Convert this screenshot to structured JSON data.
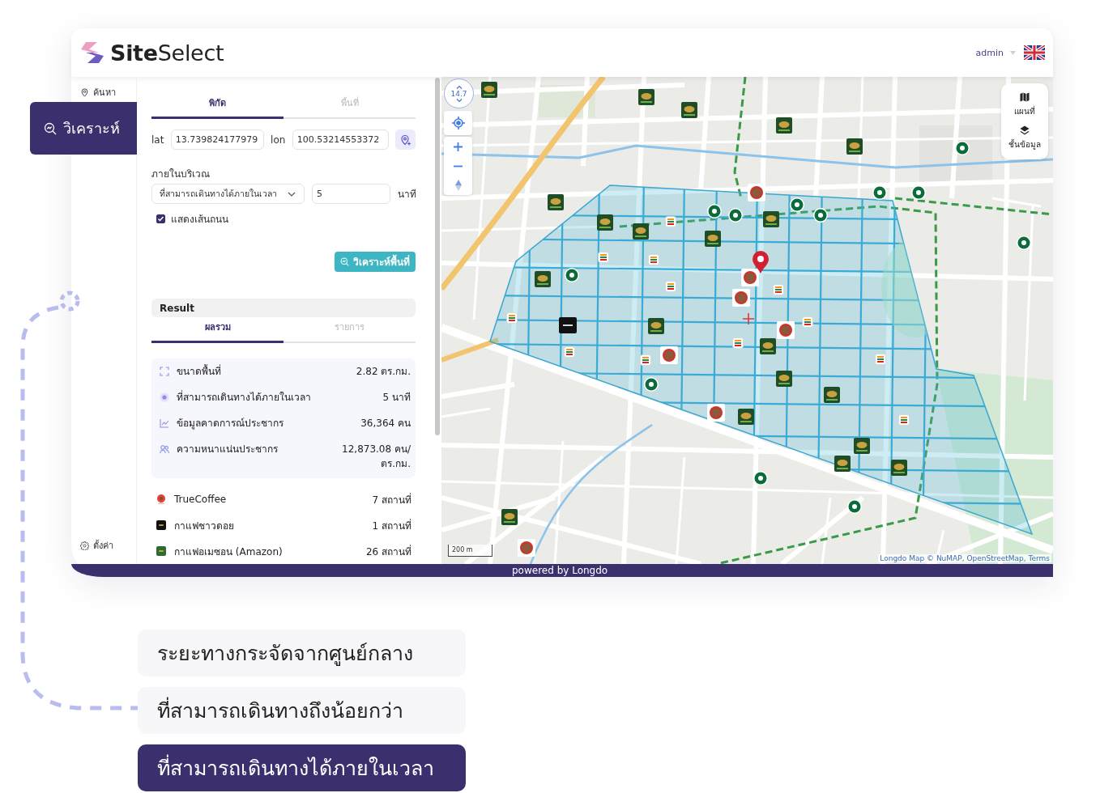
{
  "header": {
    "brand": "**Site**Select",
    "user": "admin"
  },
  "nav": {
    "items": [
      {
        "label": "ค้นหา",
        "selected": false
      },
      {
        "label": "วิเคราะห์",
        "selected": true
      }
    ],
    "settings": "ตั้งค่า"
  },
  "panel": {
    "mode_tabs": [
      {
        "label": "พิกัด",
        "selected": true
      },
      {
        "label": "พื้นที่",
        "selected": false
      }
    ],
    "lat": {
      "label": "lat",
      "value": "13.739824177979"
    },
    "lon": {
      "label": "lon",
      "value": "100.53214553372"
    },
    "area_label": "ภายในบริเวณ",
    "area_type": "ที่สามารถเดินทางได้ภายในเวลา",
    "minutes": {
      "value": "5",
      "unit": "นาที"
    },
    "show_roads": {
      "label": "แสดงเส้นถนน",
      "checked": true
    },
    "analyze_button": "วิเคราะห์พื้นที่",
    "result_title": "Result",
    "result_tabs": [
      {
        "label": "ผลรวม",
        "selected": true
      },
      {
        "label": "รายการ",
        "selected": false
      }
    ],
    "stats": [
      {
        "label": "ขนาดพื้นที่",
        "value": "2.82 ตร.กม."
      },
      {
        "label": "ที่สามารถเดินทางได้ภายในเวลา",
        "value": "5 นาที"
      },
      {
        "label": "ข้อมูลคาดการณ์ประชากร",
        "value": "36,364 คน"
      },
      {
        "label": "ความหนาแน่นประชากร",
        "value": "12,873.08 คน/ ตร.กม."
      }
    ],
    "brands": [
      {
        "kind": "pin",
        "name": "TrueCoffee",
        "count": "7 สถานที่",
        "color": "#e2463b"
      },
      {
        "kind": "tile",
        "name": "กาแฟชาวดอย",
        "count": "1 สถานที่",
        "color": "#111111"
      },
      {
        "kind": "tile",
        "name": "กาแฟอเมซอน (Amazon)",
        "count": "26 สถานที่",
        "color": "#2f6b2c"
      }
    ]
  },
  "map": {
    "zoom": "14.7",
    "layer_buttons": [
      {
        "label": "แผนที่"
      },
      {
        "label": "ชั้นข้อมูล"
      }
    ],
    "scale": "200 m",
    "attribution": "Longdo Map © NuMAP, OpenStreetMap, Terms"
  },
  "footer": "powered by Longdo",
  "options": [
    {
      "label": "ระยะทางกระจัดจากศูนย์กลาง",
      "selected": false
    },
    {
      "label": "ที่สามารถเดินทางถึงน้อยกว่า",
      "selected": false
    },
    {
      "label": "ที่สามารถเดินทางได้ภายในเวลา",
      "selected": true
    }
  ]
}
